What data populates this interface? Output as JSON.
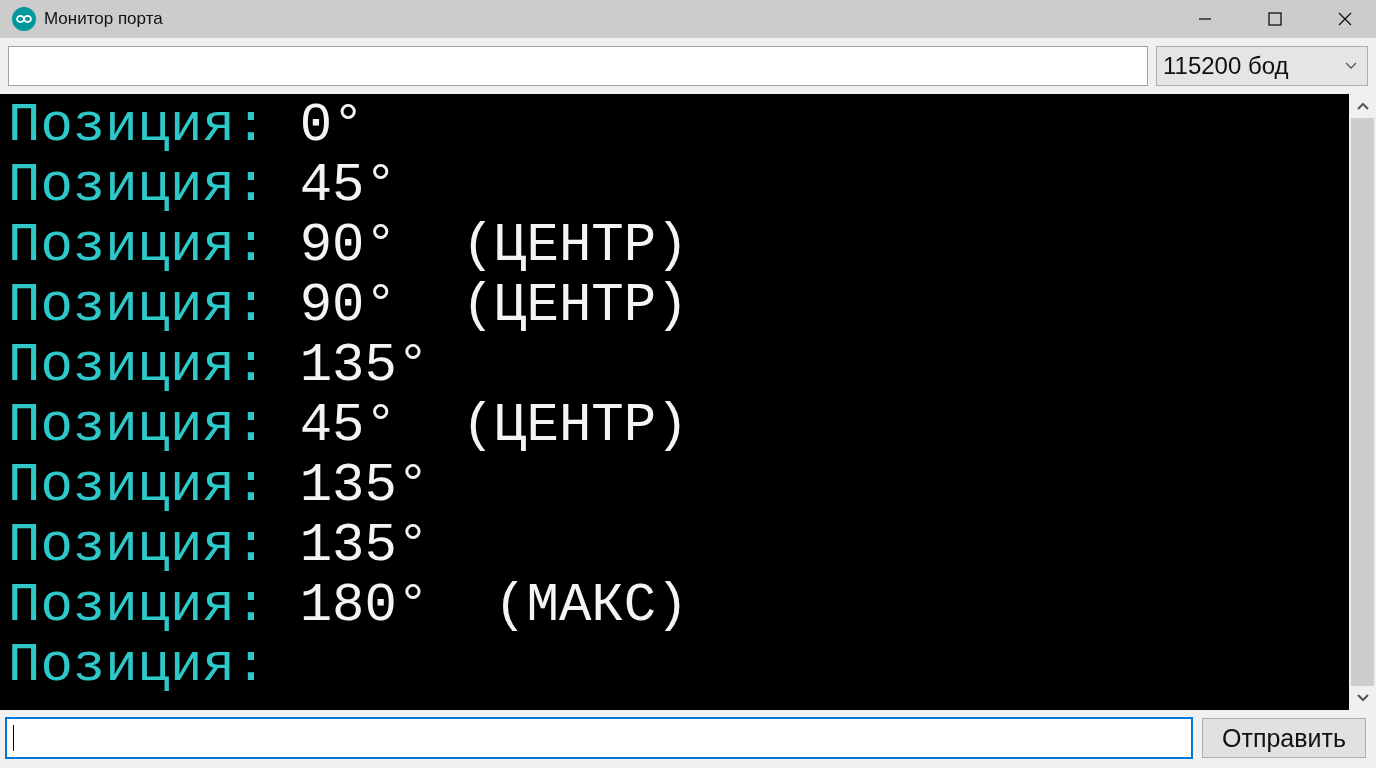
{
  "window": {
    "title": "Монитор порта"
  },
  "baud_select": {
    "value": "115200 бод"
  },
  "console": {
    "lines": [
      {
        "label": "Позиция:",
        "value": "0°"
      },
      {
        "label": "Позиция:",
        "value": "45°"
      },
      {
        "label": "Позиция:",
        "value": "90°  (ЦЕНТР)"
      },
      {
        "label": "Позиция:",
        "value": "90°  (ЦЕНТР)"
      },
      {
        "label": "Позиция:",
        "value": "135°"
      },
      {
        "label": "Позиция:",
        "value": "45°  (ЦЕНТР)"
      },
      {
        "label": "Позиция:",
        "value": "135°"
      },
      {
        "label": "Позиция:",
        "value": "135°"
      },
      {
        "label": "Позиция:",
        "value": "180°  (МАКС)"
      },
      {
        "label": "Позиция:"
      }
    ]
  },
  "send_field": {
    "focused": true
  },
  "send_button": {
    "label": "Отправить"
  }
}
